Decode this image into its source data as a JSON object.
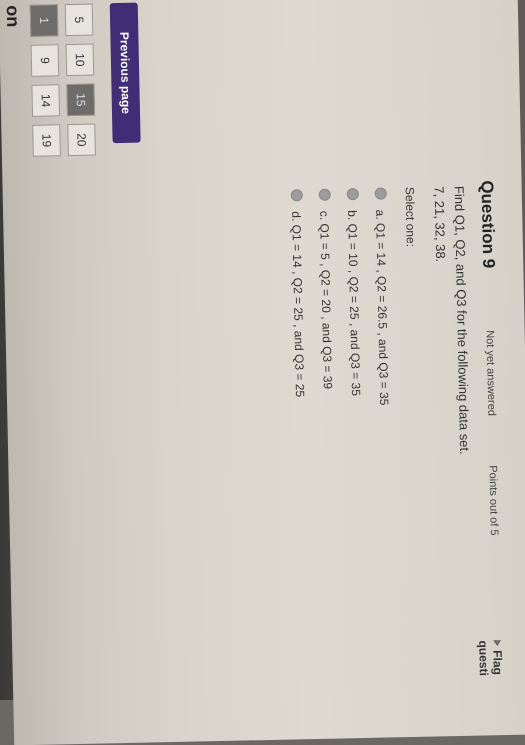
{
  "nav": {
    "title": "on",
    "cells": [
      {
        "label": "1",
        "state": "dark"
      },
      {
        "label": "5",
        "state": "light"
      },
      {
        "label": "9",
        "state": "light"
      },
      {
        "label": "10",
        "state": "light"
      },
      {
        "label": "14",
        "state": "light"
      },
      {
        "label": "15",
        "state": "dark"
      },
      {
        "label": "19",
        "state": "light"
      },
      {
        "label": "20",
        "state": "light"
      }
    ]
  },
  "question": {
    "title": "Question 9",
    "status": "Not yet answered",
    "points": "Points out of 5",
    "flag": "Flag questi",
    "prompt_line1": "Find Q1, Q2, and Q3 for the following data set.",
    "prompt_line2": "7, 21, 32, 38.",
    "select_label": "Select one:",
    "options": [
      "a. Q1 = 14 , Q2 = 26.5 , and Q3 = 35",
      "b. Q1 = 10 , Q2 = 25 , and Q3 = 35",
      "c. Q1 = 5 , Q2 = 20 , and Q3 = 39",
      "d. Q1 = 14 , Q2 = 25 , and Q3 = 25"
    ]
  },
  "buttons": {
    "previous": "Previous page"
  }
}
